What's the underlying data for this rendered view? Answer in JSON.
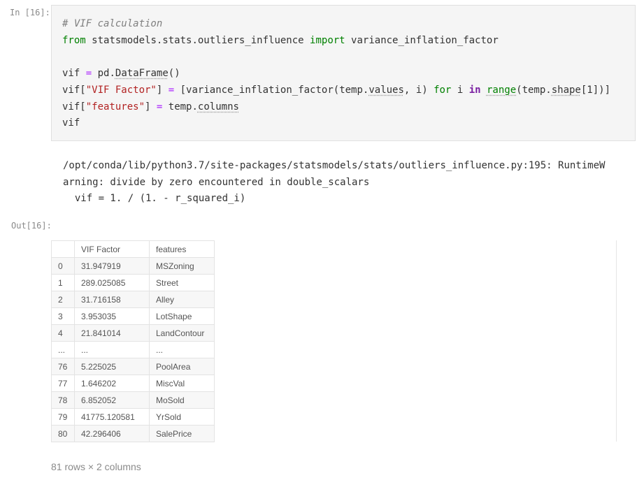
{
  "input_cell": {
    "prompt": "In [16]:",
    "code": {
      "line1": "# VIF calculation",
      "line2": {
        "kw_from": "from",
        "module": "statsmodels.stats.outliers_influence",
        "kw_import": "import",
        "name": "variance_inflation_factor"
      },
      "line3": {
        "lhs": "vif",
        "eq": "=",
        "obj": "pd.",
        "attr": "DataFrame",
        "tail": "()"
      },
      "line4": {
        "lhs": "vif[",
        "key": "\"VIF Factor\"",
        "close": "]",
        "eq": "=",
        "p1": "[variance_inflation_factor(temp.",
        "attr1": "values",
        "p2": ", i)",
        "kw_for": "for",
        "p3": "i",
        "kw_in": "in",
        "fn": "range",
        "p4": "(temp.",
        "attr2": "shape",
        "p5": "[1])]"
      },
      "line5": {
        "lhs": "vif[",
        "key": "\"features\"",
        "close": "]",
        "eq": "=",
        "obj": "temp.",
        "attr": "columns"
      },
      "line6": "vif"
    }
  },
  "stderr": {
    "line1": "/opt/conda/lib/python3.7/site-packages/statsmodels/stats/outliers_influence.py:195: RuntimeW",
    "line2": "arning: divide by zero encountered in double_scalars",
    "line3": "  vif = 1. / (1. - r_squared_i)"
  },
  "output_cell": {
    "prompt": "Out[16]:",
    "table": {
      "columns": [
        "",
        "VIF Factor",
        "features"
      ],
      "rows": [
        [
          "0",
          "31.947919",
          "MSZoning"
        ],
        [
          "1",
          "289.025085",
          "Street"
        ],
        [
          "2",
          "31.716158",
          "Alley"
        ],
        [
          "3",
          "3.953035",
          "LotShape"
        ],
        [
          "4",
          "21.841014",
          "LandContour"
        ],
        [
          "...",
          "...",
          "..."
        ],
        [
          "76",
          "5.225025",
          "PoolArea"
        ],
        [
          "77",
          "1.646202",
          "MiscVal"
        ],
        [
          "78",
          "6.852052",
          "MoSold"
        ],
        [
          "79",
          "41775.120581",
          "YrSold"
        ],
        [
          "80",
          "42.296406",
          "SalePrice"
        ]
      ]
    },
    "shape_note": "81 rows × 2 columns"
  }
}
